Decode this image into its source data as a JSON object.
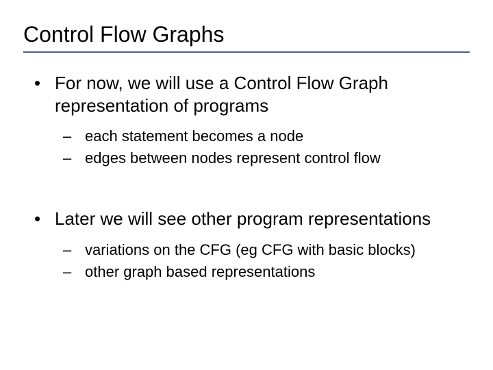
{
  "title": "Control Flow Graphs",
  "bullets": [
    {
      "text": "For now, we will use a Control Flow Graph representation of programs",
      "subs": [
        "each statement becomes a node",
        "edges between nodes represent control flow"
      ]
    },
    {
      "text": "Later we will see other program representations",
      "subs": [
        "variations on the CFG (eg CFG with basic blocks)",
        "other graph based representations"
      ]
    }
  ]
}
